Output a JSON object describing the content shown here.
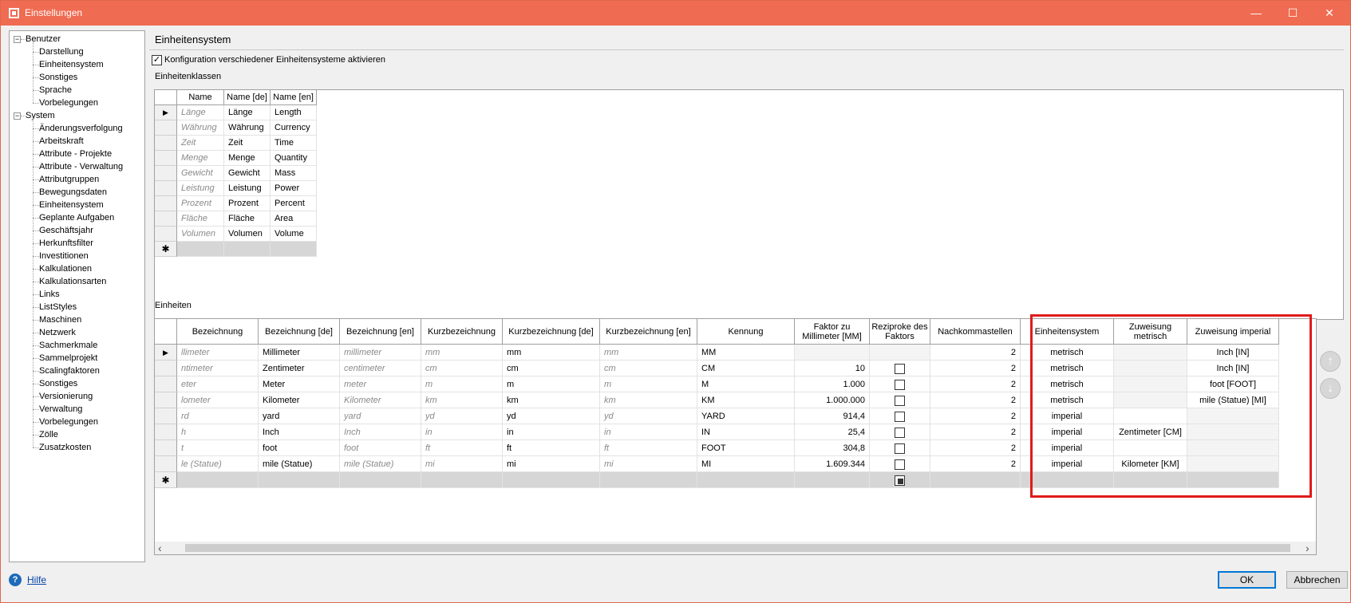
{
  "window": {
    "title": "Einstellungen",
    "minimize": "—",
    "maximize": "☐",
    "close": "✕"
  },
  "tree": {
    "groups": [
      {
        "label": "Benutzer",
        "toggle": "−",
        "items": [
          "Darstellung",
          "Einheitensystem",
          "Sonstiges",
          "Sprache",
          "Vorbelegungen"
        ]
      },
      {
        "label": "System",
        "toggle": "−",
        "items": [
          "Änderungsverfolgung",
          "Arbeitskraft",
          "Attribute - Projekte",
          "Attribute - Verwaltung",
          "Attributgruppen",
          "Bewegungsdaten",
          "Einheitensystem",
          "Geplante Aufgaben",
          "Geschäftsjahr",
          "Herkunftsfilter",
          "Investitionen",
          "Kalkulationen",
          "Kalkulationsarten",
          "Links",
          "ListStyles",
          "Maschinen",
          "Netzwerk",
          "Sachmerkmale",
          "Sammelprojekt",
          "Scalingfaktoren",
          "Sonstiges",
          "Versionierung",
          "Verwaltung",
          "Vorbelegungen",
          "Zölle",
          "Zusatzkosten"
        ]
      }
    ]
  },
  "main": {
    "title": "Einheitensystem",
    "config_checkbox": {
      "label": "Konfiguration verschiedener Einheitensysteme aktivieren",
      "checked": true,
      "mark": "✓"
    },
    "classes_label": "Einheitenklassen",
    "classes": {
      "columns": [
        "Name",
        "Name [de]",
        "Name [en]"
      ],
      "rows": [
        [
          "Länge",
          "Länge",
          "Length"
        ],
        [
          "Währung",
          "Währung",
          "Currency"
        ],
        [
          "Zeit",
          "Zeit",
          "Time"
        ],
        [
          "Menge",
          "Menge",
          "Quantity"
        ],
        [
          "Gewicht",
          "Gewicht",
          "Mass"
        ],
        [
          "Leistung",
          "Leistung",
          "Power"
        ],
        [
          "Prozent",
          "Prozent",
          "Percent"
        ],
        [
          "Fläche",
          "Fläche",
          "Area"
        ],
        [
          "Volumen",
          "Volumen",
          "Volume"
        ]
      ],
      "current_marker": "▶",
      "new_marker": "✱"
    },
    "units_label": "Einheiten",
    "units": {
      "columns": [
        "Bezeichnung",
        "Bezeichnung [de]",
        "Bezeichnung [en]",
        "Kurzbezeichnung",
        "Kurzbezeichnung [de]",
        "Kurzbezeichnung [en]",
        "Kennung",
        "Faktor zu Millimeter [MM]",
        "Reziproke des Faktors",
        "Nachkommastellen",
        "Einheitensystem",
        "Zuweisung metrisch",
        "Zuweisung imperial"
      ],
      "rows": [
        {
          "bez": "llimeter",
          "bez_de": "Millimeter",
          "bez_en": "millimeter",
          "kurz": "mm",
          "kurz_de": "mm",
          "kurz_en": "mm",
          "kennung": "MM",
          "faktor": "",
          "reziprok": null,
          "nk": "2",
          "system": "metrisch",
          "metrisch": "",
          "imperial": "Inch [IN]"
        },
        {
          "bez": "ntimeter",
          "bez_de": "Zentimeter",
          "bez_en": "centimeter",
          "kurz": "cm",
          "kurz_de": "cm",
          "kurz_en": "cm",
          "kennung": "CM",
          "faktor": "10",
          "reziprok": false,
          "nk": "2",
          "system": "metrisch",
          "metrisch": "",
          "imperial": "Inch [IN]"
        },
        {
          "bez": "eter",
          "bez_de": "Meter",
          "bez_en": "meter",
          "kurz": "m",
          "kurz_de": "m",
          "kurz_en": "m",
          "kennung": "M",
          "faktor": "1.000",
          "reziprok": false,
          "nk": "2",
          "system": "metrisch",
          "metrisch": "",
          "imperial": "foot [FOOT]"
        },
        {
          "bez": "lometer",
          "bez_de": "Kilometer",
          "bez_en": "Kilometer",
          "kurz": "km",
          "kurz_de": "km",
          "kurz_en": "km",
          "kennung": "KM",
          "faktor": "1.000.000",
          "reziprok": false,
          "nk": "2",
          "system": "metrisch",
          "metrisch": "",
          "imperial": "mile (Statue) [MI]"
        },
        {
          "bez": "rd",
          "bez_de": "yard",
          "bez_en": "yard",
          "kurz": "yd",
          "kurz_de": "yd",
          "kurz_en": "yd",
          "kennung": "YARD",
          "faktor": "914,4",
          "reziprok": false,
          "nk": "2",
          "system": "imperial",
          "metrisch": "",
          "imperial": ""
        },
        {
          "bez": "h",
          "bez_de": "Inch",
          "bez_en": "Inch",
          "kurz": "in",
          "kurz_de": "in",
          "kurz_en": "in",
          "kennung": "IN",
          "faktor": "25,4",
          "reziprok": false,
          "nk": "2",
          "system": "imperial",
          "metrisch": "Zentimeter [CM]",
          "imperial": ""
        },
        {
          "bez": "t",
          "bez_de": "foot",
          "bez_en": "foot",
          "kurz": "ft",
          "kurz_de": "ft",
          "kurz_en": "ft",
          "kennung": "FOOT",
          "faktor": "304,8",
          "reziprok": false,
          "nk": "2",
          "system": "imperial",
          "metrisch": "",
          "imperial": ""
        },
        {
          "bez": "le (Statue)",
          "bez_de": "mile (Statue)",
          "bez_en": "mile (Statue)",
          "kurz": "mi",
          "kurz_de": "mi",
          "kurz_en": "mi",
          "kennung": "MI",
          "faktor": "1.609.344",
          "reziprok": false,
          "nk": "2",
          "system": "imperial",
          "metrisch": "Kilometer [KM]",
          "imperial": ""
        }
      ],
      "gray_columns": [
        "bez",
        "bez_en",
        "kurz",
        "kurz_en"
      ],
      "current_marker": "▶",
      "new_marker": "✱"
    },
    "move_up": "↑",
    "move_down": "↓",
    "scroll_left": "‹",
    "scroll_right": "›"
  },
  "footer": {
    "help_icon": "?",
    "help_label": "Hilfe",
    "ok_label": "OK",
    "cancel_label": "Abbrechen"
  },
  "colors": {
    "titlebar": "#ef6b51",
    "highlight": "#e01b1b",
    "link": "#0645ad",
    "ok_border": "#0078d7"
  }
}
